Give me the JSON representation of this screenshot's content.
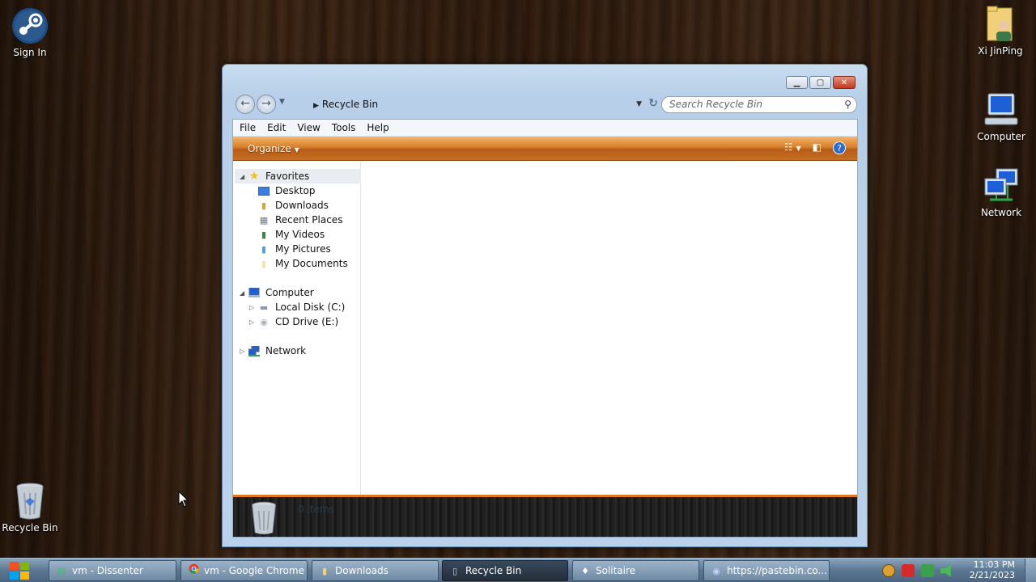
{
  "desktop": {
    "icons": [
      {
        "label": "Sign In",
        "icon": "steam-icon"
      },
      {
        "label": "Xi JinPing",
        "icon": "user-folder-icon"
      },
      {
        "label": "Computer",
        "icon": "computer-icon"
      },
      {
        "label": "Network",
        "icon": "network-icon"
      },
      {
        "label": "Recycle Bin",
        "icon": "recycle-bin-icon"
      }
    ]
  },
  "window": {
    "address": "Recycle Bin",
    "search_placeholder": "Search Recycle Bin",
    "menu": [
      "File",
      "Edit",
      "View",
      "Tools",
      "Help"
    ],
    "organize_label": "Organize",
    "help_glyph": "?",
    "nav": {
      "favorites": "Favorites",
      "favorites_items": [
        "Desktop",
        "Downloads",
        "Recent Places",
        "My Videos",
        "My Pictures",
        "My Documents"
      ],
      "computer": "Computer",
      "computer_items": [
        "Local Disk (C:)",
        "CD Drive (E:)"
      ],
      "network": "Network"
    },
    "details_text": "0 items"
  },
  "taskbar": {
    "tasks": [
      {
        "label": "vm - Dissenter",
        "icon": "dissenter-icon"
      },
      {
        "label": "vm - Google Chrome",
        "icon": "chrome-icon"
      },
      {
        "label": "Downloads",
        "icon": "folder-icon"
      },
      {
        "label": "Recycle Bin",
        "icon": "recycle-bin-icon"
      },
      {
        "label": "Solitaire",
        "icon": "solitaire-icon"
      },
      {
        "label": "https://pastebin.co...",
        "icon": "discord-icon"
      }
    ],
    "active_task": "Recycle Bin",
    "time": "11:03 PM",
    "date": "2/21/2023"
  },
  "colors": {
    "command_bar": "#d77e2a",
    "details_border": "#e07a1f",
    "active_task": "#222d39"
  }
}
